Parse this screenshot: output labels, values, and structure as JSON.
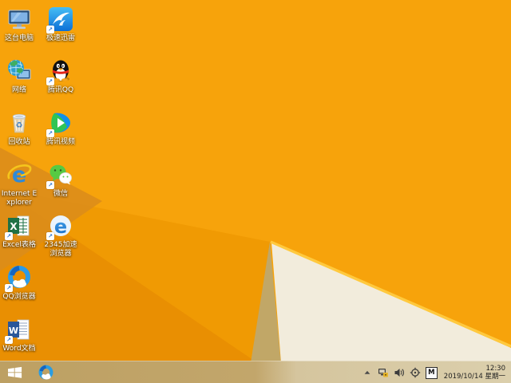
{
  "wallpaper": {
    "base": "#F7A30B",
    "facet_mid": "#F09A03",
    "facet_deep": "#E98F02",
    "facet_left_dark": "#DC8D1A",
    "fold_tan": "#C1A767",
    "fold_cream": "#F2ECDC",
    "fold_highlight": "#FFC93E"
  },
  "desktop": {
    "icons": [
      {
        "label": "这台电脑",
        "icon": "this-pc-icon",
        "shortcut": false
      },
      {
        "label": "极速迅雷",
        "icon": "xunlei-icon",
        "shortcut": true
      },
      {
        "label": "网络",
        "icon": "network-icon",
        "shortcut": false
      },
      {
        "label": "腾讯QQ",
        "icon": "tencent-qq-icon",
        "shortcut": true
      },
      {
        "label": "回收站",
        "icon": "recycle-bin-icon",
        "shortcut": false
      },
      {
        "label": "腾讯视频",
        "icon": "tencent-video-icon",
        "shortcut": true
      },
      {
        "label": "Internet Explorer",
        "icon": "internet-explorer-icon",
        "shortcut": false
      },
      {
        "label": "微信",
        "icon": "wechat-icon",
        "shortcut": true
      },
      {
        "label": "Excel表格",
        "icon": "excel-icon",
        "shortcut": true
      },
      {
        "label": "2345加速浏览器",
        "icon": "2345-browser-icon",
        "shortcut": true
      },
      {
        "label": "QQ浏览器",
        "icon": "qq-browser-icon",
        "shortcut": true
      },
      {
        "label": "Word文档",
        "icon": "word-icon",
        "shortcut": true
      }
    ]
  },
  "icon_glyphs": {
    "shortcut_arrow": "↗",
    "ie_letter": "e",
    "browser_2345_letter": "e",
    "excel_letter": "X",
    "word_letter": "W",
    "recycle_symbol": "♻"
  },
  "taskbar": {
    "pinned_icons": [
      "qq-browser-taskbar-icon"
    ],
    "tray": {
      "icons": [
        "hidden-icons-chevron",
        "network-status-icon",
        "volume-icon",
        "utility-crosshair-icon",
        "ime-indicator"
      ],
      "ime_label": "M",
      "time": "12:30",
      "date": "2019/10/14 星期一"
    }
  }
}
